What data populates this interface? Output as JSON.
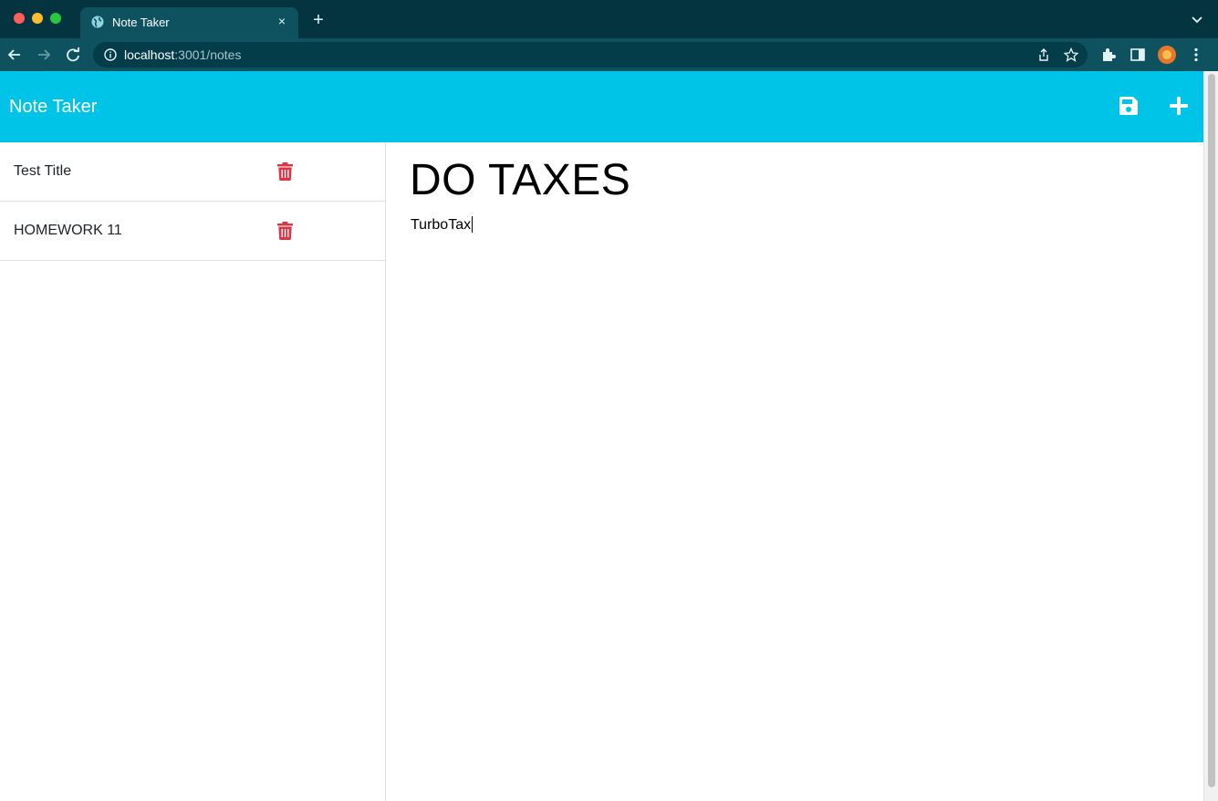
{
  "browser": {
    "tab_title": "Note Taker",
    "tab_close": "×",
    "new_tab": "+",
    "url_host": "localhost",
    "url_path": ":3001/notes"
  },
  "app": {
    "brand": "Note Taker",
    "accent_color": "#00c3e8",
    "danger_color": "#dc3545",
    "notes": [
      {
        "title": "Test Title"
      },
      {
        "title": "HOMEWORK 11"
      }
    ],
    "active_note": {
      "title": "DO TAXES",
      "text": "TurboTax"
    }
  }
}
